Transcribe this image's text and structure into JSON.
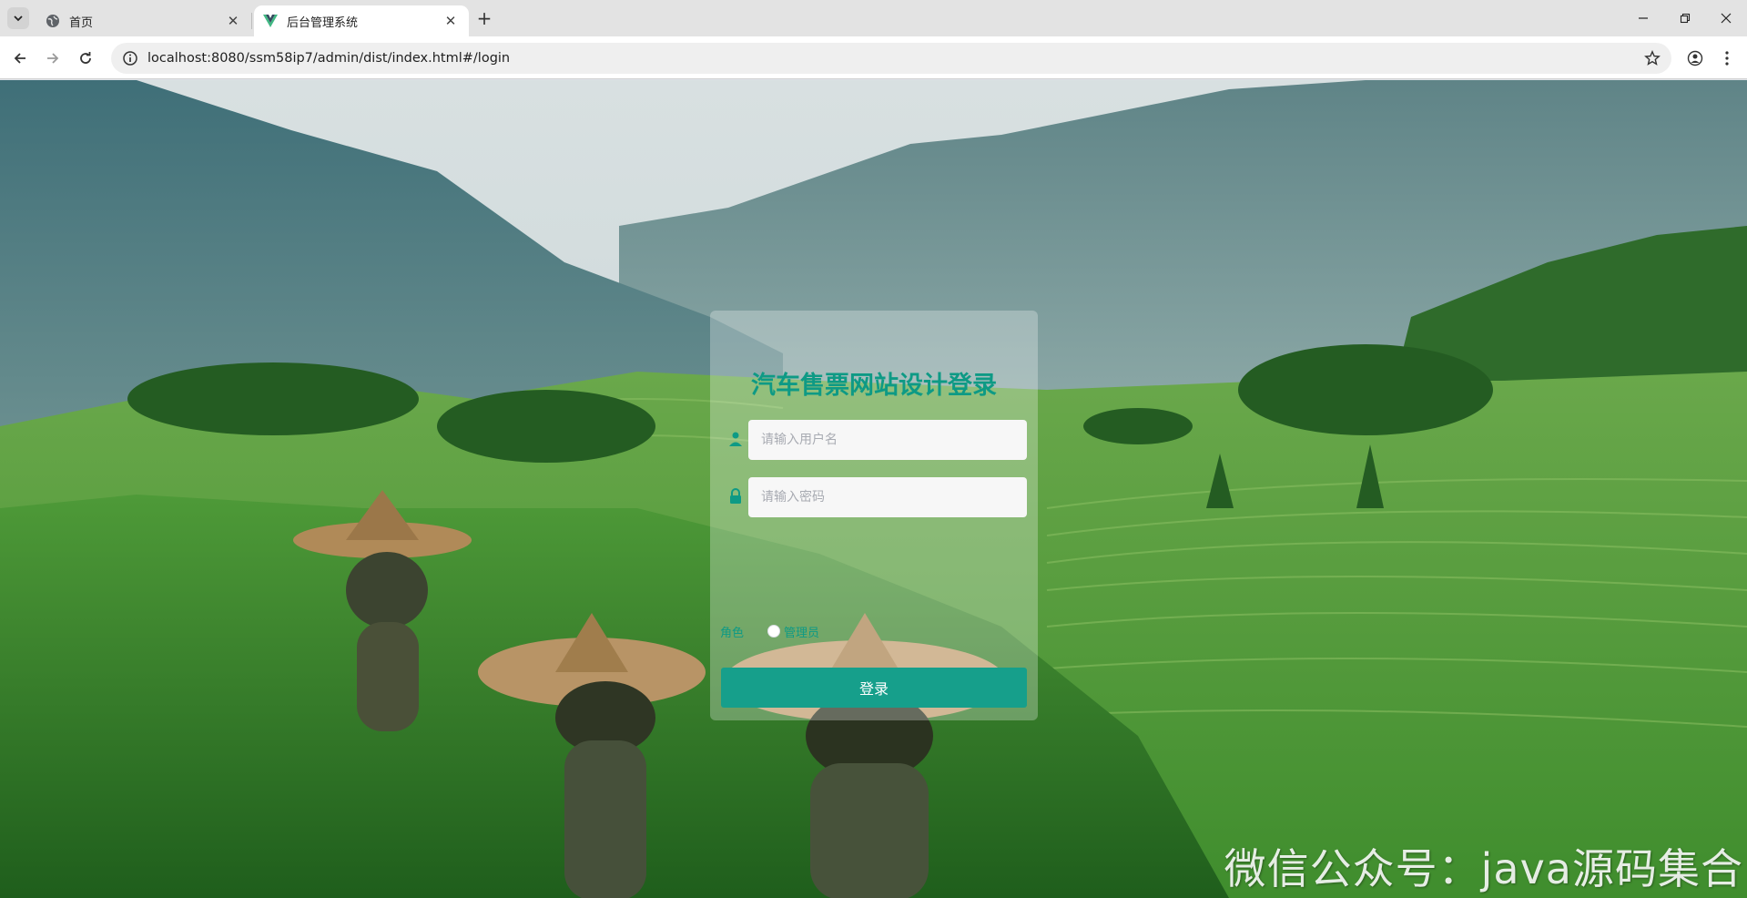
{
  "browser": {
    "tabs": [
      {
        "title": "首页",
        "active": false
      },
      {
        "title": "后台管理系统",
        "active": true
      }
    ],
    "url": "localhost:8080/ssm58ip7/admin/dist/index.html#/login",
    "icons": {
      "tab_list": "chevron-down-icon",
      "globe": "globe-icon",
      "vue": "vue-logo-icon",
      "close": "close-icon",
      "new_tab": "plus-icon",
      "back": "arrow-left-icon",
      "forward": "arrow-right-icon",
      "reload": "reload-icon",
      "info": "info-icon",
      "bookmark": "star-icon",
      "profile": "profile-icon",
      "menu": "kebab-menu-icon",
      "minimize": "minimize-icon",
      "restore": "restore-icon",
      "window_close": "close-icon"
    }
  },
  "login": {
    "title": "汽车售票网站设计登录",
    "username_placeholder": "请输入用户名",
    "password_placeholder": "请输入密码",
    "role_label": "角色",
    "role_option": "管理员",
    "submit_label": "登录",
    "accent_color": "#0e9a85"
  },
  "watermark": "微信公众号：java源码集合"
}
